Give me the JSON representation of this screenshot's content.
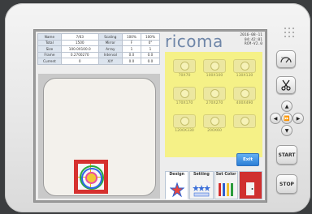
{
  "brand": "ricoma",
  "status": {
    "date": "2016-08-11",
    "time": "04:42:01",
    "version": "RCM-V2.0"
  },
  "info_table": {
    "rows": [
      [
        "Name",
        "7/63",
        "Scaling",
        "100%",
        "100%"
      ],
      [
        "Total",
        "1500",
        "Mirror",
        "F",
        "0°"
      ],
      [
        "Size",
        "100.0X100.0",
        "Array",
        "1",
        "1"
      ],
      [
        "Frame",
        "0.2700270",
        "Interval",
        "0.0",
        "0.0"
      ],
      [
        "Current",
        "0",
        "X/Y",
        "0.0",
        "0.0"
      ]
    ]
  },
  "size_buttons": [
    {
      "label": "70X70",
      "icon": "frame-70-icon"
    },
    {
      "label": "100X100",
      "icon": "frame-100-icon"
    },
    {
      "label": "130X130",
      "icon": "frame-130-icon"
    },
    {
      "label": "170X170",
      "icon": "frame-170-icon"
    },
    {
      "label": "270X270",
      "icon": "frame-270-icon"
    },
    {
      "label": "400X490",
      "icon": "frame-400-icon"
    },
    {
      "label": "1200X330",
      "icon": "frame-1200-icon"
    },
    {
      "label": "200X60",
      "icon": "frame-200-icon"
    },
    {
      "label": "",
      "icon": "frame-blank-icon"
    }
  ],
  "exit_label": "Exit",
  "tabs": [
    {
      "label": "Design",
      "icon": "design-star-icon"
    },
    {
      "label": "Setting",
      "icon": "setting-stars-icon"
    },
    {
      "label": "Set Color",
      "icon": "color-bars-icon"
    },
    {
      "label": "",
      "icon": "exit-door-icon"
    }
  ],
  "hardware": {
    "start_label": "START",
    "stop_label": "STOP"
  },
  "colors": {
    "size_panel": "#f5f187",
    "design_frame": "#d6312f",
    "exit_button": "#2d7fd6",
    "brand_text": "#6f86a8"
  }
}
